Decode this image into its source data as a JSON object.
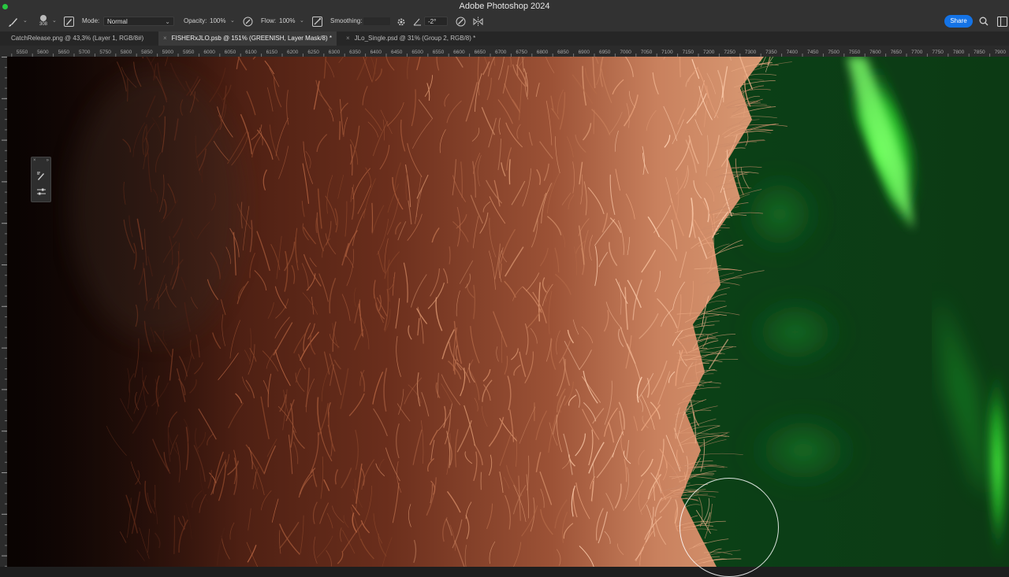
{
  "app": {
    "window_title": "Adobe Photoshop 2024"
  },
  "options_bar": {
    "tool_icon": "brush-icon",
    "brush_size": "308",
    "mode_label": "Mode:",
    "mode_value": "Normal",
    "opacity_label": "Opacity:",
    "opacity_value": "100%",
    "flow_label": "Flow:",
    "flow_value": "100%",
    "smoothing_label": "Smoothing:",
    "smoothing_value": "",
    "angle_value": "-2°",
    "share_label": "Share"
  },
  "tabs": [
    {
      "label": "CatchRelease.png @ 43,3% (Layer 1, RGB/8#)",
      "active": false
    },
    {
      "label": "FISHERxJLO.psb @ 151% (GREENISH, Layer Mask/8) *",
      "active": true
    },
    {
      "label": "JLo_Single.psd @ 31% (Group 2, RGB/8) *",
      "active": false
    }
  ],
  "ruler": {
    "h_ticks": [
      "5550",
      "5600",
      "5650",
      "5700",
      "5750",
      "5800",
      "5850",
      "5900",
      "5950",
      "6000",
      "6050",
      "6100",
      "6150",
      "6200",
      "6250",
      "6300",
      "6350",
      "6400",
      "6450",
      "6500",
      "6550",
      "6600",
      "6650",
      "6700",
      "6750",
      "6800",
      "6850",
      "6900",
      "6950",
      "7000",
      "7050",
      "7100",
      "7150",
      "7200",
      "7250",
      "7300",
      "7350",
      "7400",
      "7450",
      "7500",
      "7550",
      "7600",
      "7650",
      "7700",
      "7750",
      "7800",
      "7850",
      "7900"
    ]
  },
  "colors": {
    "chrome": "#323232",
    "tabbar": "#262626",
    "accent": "#1473e6",
    "fur_dark": "#3a1810",
    "fur_light": "#d9916e",
    "green_bg": "#0a3a12",
    "green_glow": "#3dff3a"
  }
}
